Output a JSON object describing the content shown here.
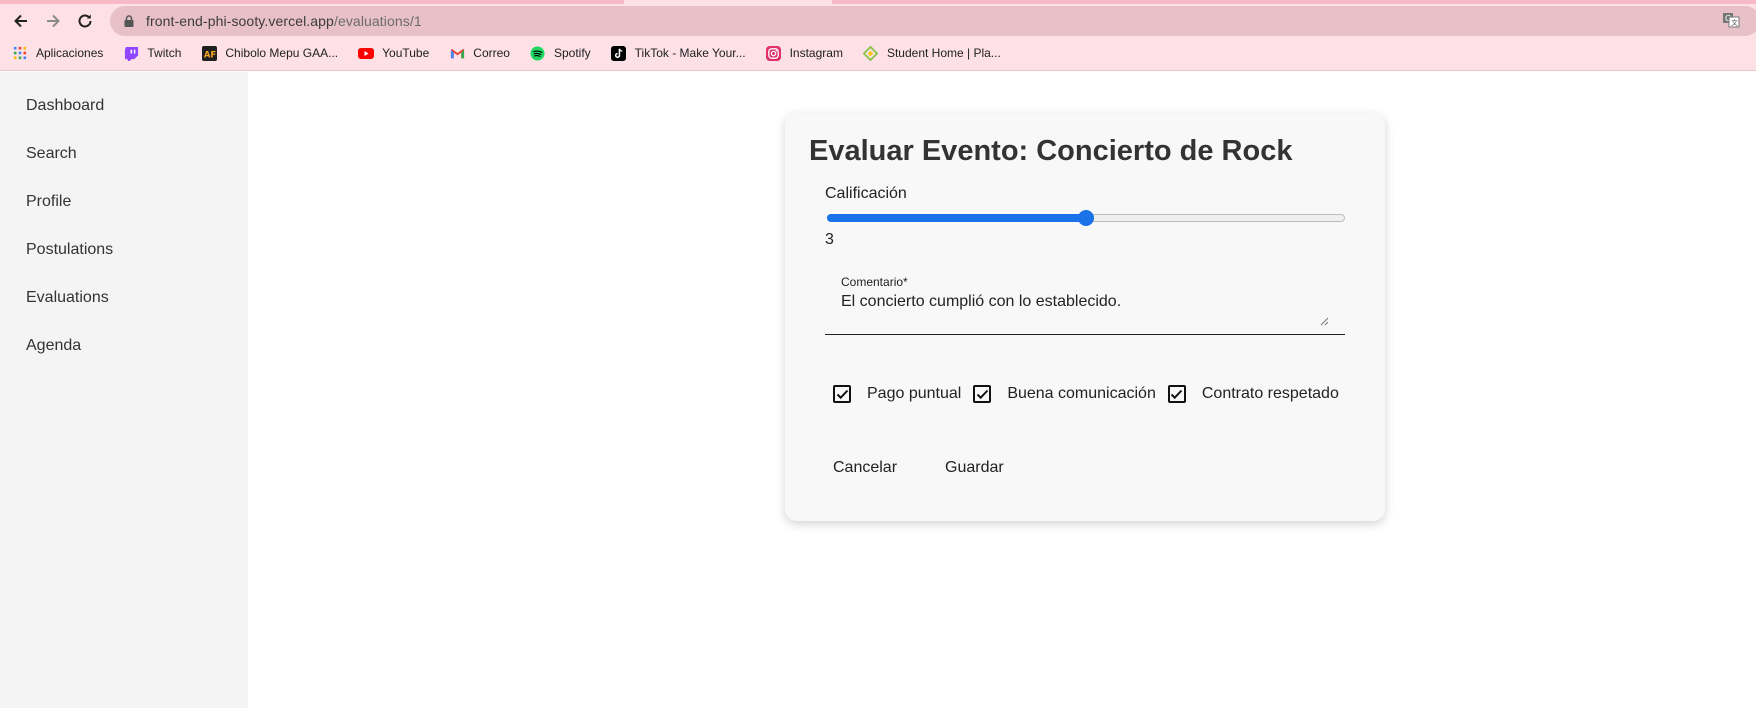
{
  "browser": {
    "url_host": "front-end-phi-sooty.vercel.app",
    "url_path": "/evaluations/1",
    "bookmarks": [
      {
        "label": "Aplicaciones",
        "icon": "apps-grid-icon",
        "color": "#4285f4"
      },
      {
        "label": "Twitch",
        "icon": "twitch-icon",
        "color": "#9146ff"
      },
      {
        "label": "Chibolo Mepu GAA...",
        "icon": "af-logo-icon",
        "color": "#1f1f1f"
      },
      {
        "label": "YouTube",
        "icon": "youtube-icon",
        "color": "#ff0000"
      },
      {
        "label": "Correo",
        "icon": "gmail-icon",
        "color": "#ea4335"
      },
      {
        "label": "Spotify",
        "icon": "spotify-icon",
        "color": "#1ed760"
      },
      {
        "label": "TikTok - Make Your...",
        "icon": "tiktok-icon",
        "color": "#000000"
      },
      {
        "label": "Instagram",
        "icon": "instagram-icon",
        "color": "#e1306c"
      },
      {
        "label": "Student Home | Pla...",
        "icon": "student-home-icon",
        "color": "#8bc34a"
      }
    ]
  },
  "sidebar": {
    "items": [
      {
        "label": "Dashboard"
      },
      {
        "label": "Search"
      },
      {
        "label": "Profile"
      },
      {
        "label": "Postulations"
      },
      {
        "label": "Evaluations"
      },
      {
        "label": "Agenda"
      }
    ]
  },
  "form": {
    "title": "Evaluar Evento: Concierto de Rock",
    "rating_label": "Calificación",
    "rating_value": "3",
    "rating_fraction": 0.5,
    "comment_label": "Comentario*",
    "comment_value": "El concierto cumplió con lo establecido.",
    "checkboxes": [
      {
        "label": "Pago puntual",
        "checked": true
      },
      {
        "label": "Buena comunicación",
        "checked": true
      },
      {
        "label": "Contrato respetado",
        "checked": true
      }
    ],
    "cancel_label": "Cancelar",
    "save_label": "Guardar"
  },
  "colors": {
    "accent": "#1a73e8",
    "chrome_bg": "#fde1e6",
    "sidebar_bg": "#f4f4f4",
    "card_bg": "#f8f8f8"
  }
}
